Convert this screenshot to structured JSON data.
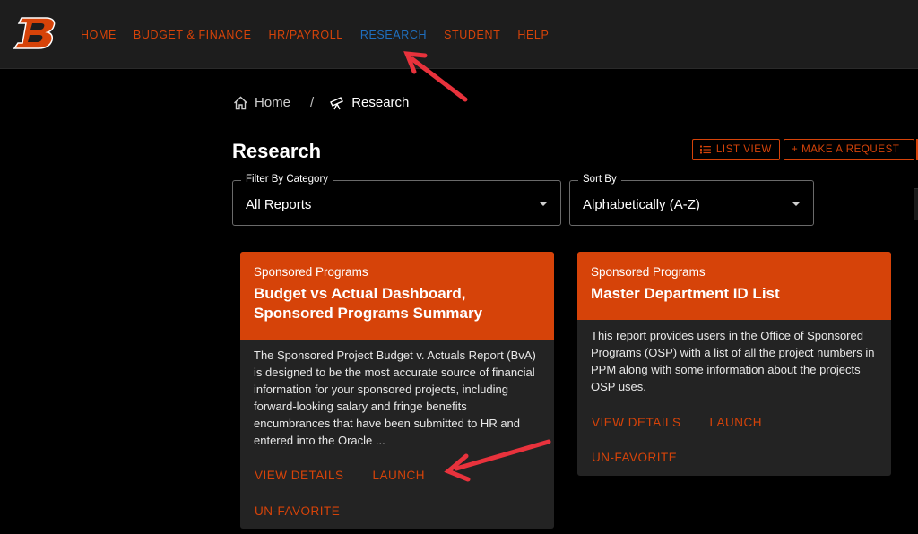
{
  "nav": {
    "items": [
      {
        "label": "HOME",
        "active": false
      },
      {
        "label": "BUDGET & FINANCE",
        "active": false
      },
      {
        "label": "HR/PAYROLL",
        "active": false
      },
      {
        "label": "RESEARCH",
        "active": true
      },
      {
        "label": "STUDENT",
        "active": false
      },
      {
        "label": "HELP",
        "active": false
      }
    ]
  },
  "breadcrumb": {
    "home": "Home",
    "separator": "/",
    "current": "Research"
  },
  "page": {
    "title": "Research",
    "list_view_label": "LIST VIEW",
    "make_request_label": "+ MAKE A REQUEST"
  },
  "filters": {
    "category_label": "Filter By Category",
    "category_value": "All Reports",
    "sort_label": "Sort By",
    "sort_value": "Alphabetically (A-Z)"
  },
  "cards": [
    {
      "category": "Sponsored Programs",
      "title_line1": "Budget vs Actual Dashboard,",
      "title_line2": "Sponsored Programs Summary",
      "description": "The Sponsored Project Budget v. Actuals Report (BvA) is designed to be the most accurate source of financial information for your sponsored projects, including forward-looking salary and fringe benefits encumbrances that have been submitted to HR and entered into the Oracle ...",
      "view_details": "VIEW DETAILS",
      "launch": "LAUNCH",
      "unfavorite": "UN-FAVORITE"
    },
    {
      "category": "Sponsored Programs",
      "title_line1": "Master Department ID List",
      "description": "This report provides users in the Office of Sponsored Programs (OSP) with a list of all the project numbers in PPM along with some information about the projects OSP uses.",
      "view_details": "VIEW DETAILS",
      "launch": "LAUNCH",
      "unfavorite": "UN-FAVORITE"
    }
  ],
  "colors": {
    "accent": "#d64309",
    "active_nav": "#1f6fbf",
    "annotation_arrow": "#e8323c"
  }
}
